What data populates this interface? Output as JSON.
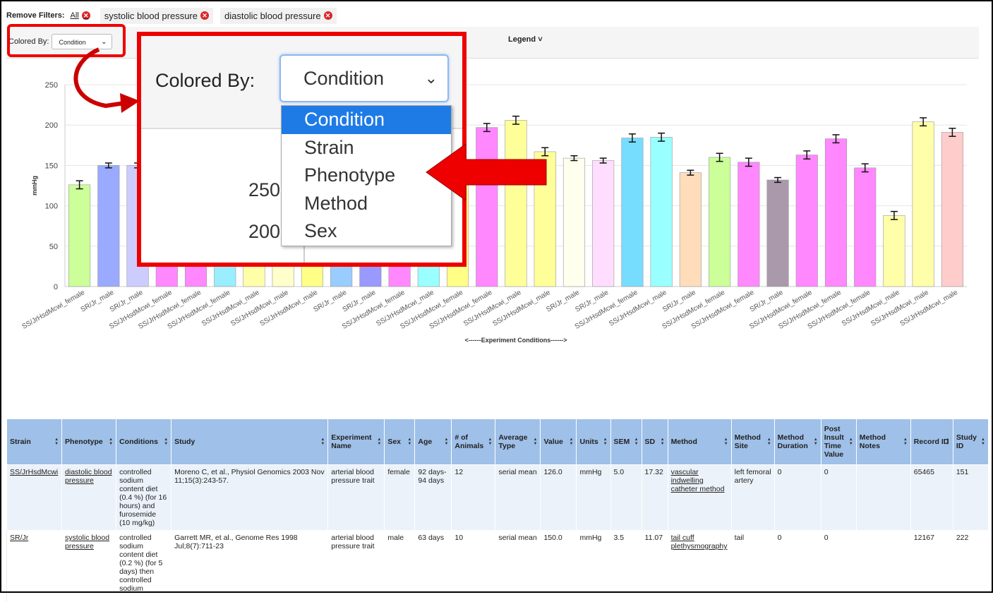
{
  "filters": {
    "label": "Remove Filters:",
    "all": "All",
    "chips": [
      "systolic blood pressure",
      "diastolic blood pressure"
    ]
  },
  "toolbar": {
    "colored_by_label": "Colored By:",
    "colored_by_value": "Condition",
    "legend_label": "Legend"
  },
  "callout": {
    "colored_by_label": "Colored By:",
    "selected": "Condition",
    "options": [
      "Condition",
      "Strain",
      "Phenotype",
      "Method",
      "Sex"
    ],
    "ticks": [
      "250",
      "200"
    ]
  },
  "chart_data": {
    "type": "bar",
    "ylabel": "mmHg",
    "xlabel": "<------Experiment Conditions------>",
    "ylim": [
      0,
      250
    ],
    "yticks": [
      0,
      50,
      100,
      150,
      200,
      250
    ],
    "categories": [
      "SS/JrHsdMcwi_female",
      "SR/Jr_male",
      "SR/Jr_male",
      "SS/JrHsdMcwi_female",
      "SS/JrHsdMcwi_female",
      "SS/JrHsdMcwi_female",
      "SS/JrHsdMcwi_male",
      "SS/JrHsdMcwi_male",
      "SS/JrHsdMcwi_male",
      "SR/Jr_male",
      "SR/Jr_male",
      "SS/JrHsdMcwi_female",
      "SS/JrHsdMcwi_male",
      "SS/JrHsdMcwi_female",
      "SS/JrHsdMcwi_female",
      "SS/JrHsdMcwi_male",
      "SS/JrHsdMcwi_male",
      "SR/Jr_male",
      "SR/Jr_male",
      "SS/JrHsdMcwi_female",
      "SS/JrHsdMcwi_male",
      "SR/Jr_male",
      "SS/JrHsdMcwi_female",
      "SS/JrHsdMcwi_female",
      "SR/Jr_male",
      "SS/JrHsdMcwi_female",
      "SS/JrHsdMcwi_female",
      "SS/JrHsdMcwi_female",
      "SS/JrHsdMcwi_male",
      "SS/JrHsdMcwi_male",
      "SS/JrHsdMcwi_male"
    ],
    "values": [
      126,
      150,
      150,
      150,
      150,
      150,
      150,
      150,
      150,
      150,
      150,
      150,
      150,
      150,
      197,
      206,
      167,
      159,
      156,
      184,
      185,
      141,
      160,
      154,
      132,
      163,
      183,
      147,
      88,
      204,
      191
    ],
    "errors": [
      5,
      3,
      3,
      3,
      3,
      3,
      3,
      3,
      3,
      3,
      3,
      3,
      3,
      3,
      5,
      5,
      5,
      3,
      3,
      5,
      5,
      3,
      5,
      5,
      3,
      5,
      5,
      5,
      5,
      5,
      5
    ],
    "colors": [
      "#ccff99",
      "#99aaff",
      "#ccccff",
      "#ff88ff",
      "#ff88ff",
      "#99eeff",
      "#ffffaa",
      "#ffffcc",
      "#ffff88",
      "#99ccff",
      "#9999ff",
      "#ff88ff",
      "#99ffff",
      "#ffff88",
      "#ff88ff",
      "#ffff99",
      "#ffff99",
      "#ffffee",
      "#ffddff",
      "#77ddff",
      "#99ffff",
      "#ffddbb",
      "#ccff99",
      "#ff88ff",
      "#aa99aa",
      "#ff88ff",
      "#ff88ff",
      "#ff88ff",
      "#ffffaa",
      "#ffffaa",
      "#ffcccc"
    ]
  },
  "table": {
    "headers": [
      "Strain",
      "Phenotype",
      "Conditions",
      "Study",
      "Experiment Name",
      "Sex",
      "Age",
      "# of Animals",
      "Average Type",
      "Value",
      "Units",
      "SEM",
      "SD",
      "Method",
      "Method Site",
      "Method Duration",
      "Post Insult Time Value",
      "Method Notes",
      "Record ID",
      "Study ID"
    ],
    "rows": [
      {
        "strain": "SS/JrHsdMcwi",
        "phenotype": "diastolic blood pressure",
        "conditions": "controlled sodium content diet (0.4 %) (for 16 hours) and furosemide (10 mg/kg)",
        "study": "Moreno C, et al., Physiol Genomics 2003 Nov 11;15(3):243-57.",
        "experiment": "arterial blood pressure trait",
        "sex": "female",
        "age": "92 days-94 days",
        "animals": "12",
        "avg_type": "serial mean",
        "value": "126.0",
        "units": "mmHg",
        "sem": "5.0",
        "sd": "17.32",
        "method": "vascular indwelling catheter method",
        "method_site": "left femoral artery",
        "method_duration": "0",
        "post_insult": "0",
        "method_notes": "",
        "record_id": "65465",
        "study_id": "151"
      },
      {
        "strain": "SR/Jr",
        "phenotype": "systolic blood pressure",
        "conditions": "controlled sodium content diet (0.2 %) (for 5 days) then controlled sodium",
        "study": "Garrett MR, et al., Genome Res 1998 Jul;8(7):711-23",
        "experiment": "arterial blood pressure trait",
        "sex": "male",
        "age": "63 days",
        "animals": "10",
        "avg_type": "serial mean",
        "value": "150.0",
        "units": "mmHg",
        "sem": "3.5",
        "sd": "11.07",
        "method": "tail cuff plethysmography",
        "method_site": "tail",
        "method_duration": "0",
        "post_insult": "0",
        "method_notes": "",
        "record_id": "12167",
        "study_id": "222"
      }
    ]
  }
}
